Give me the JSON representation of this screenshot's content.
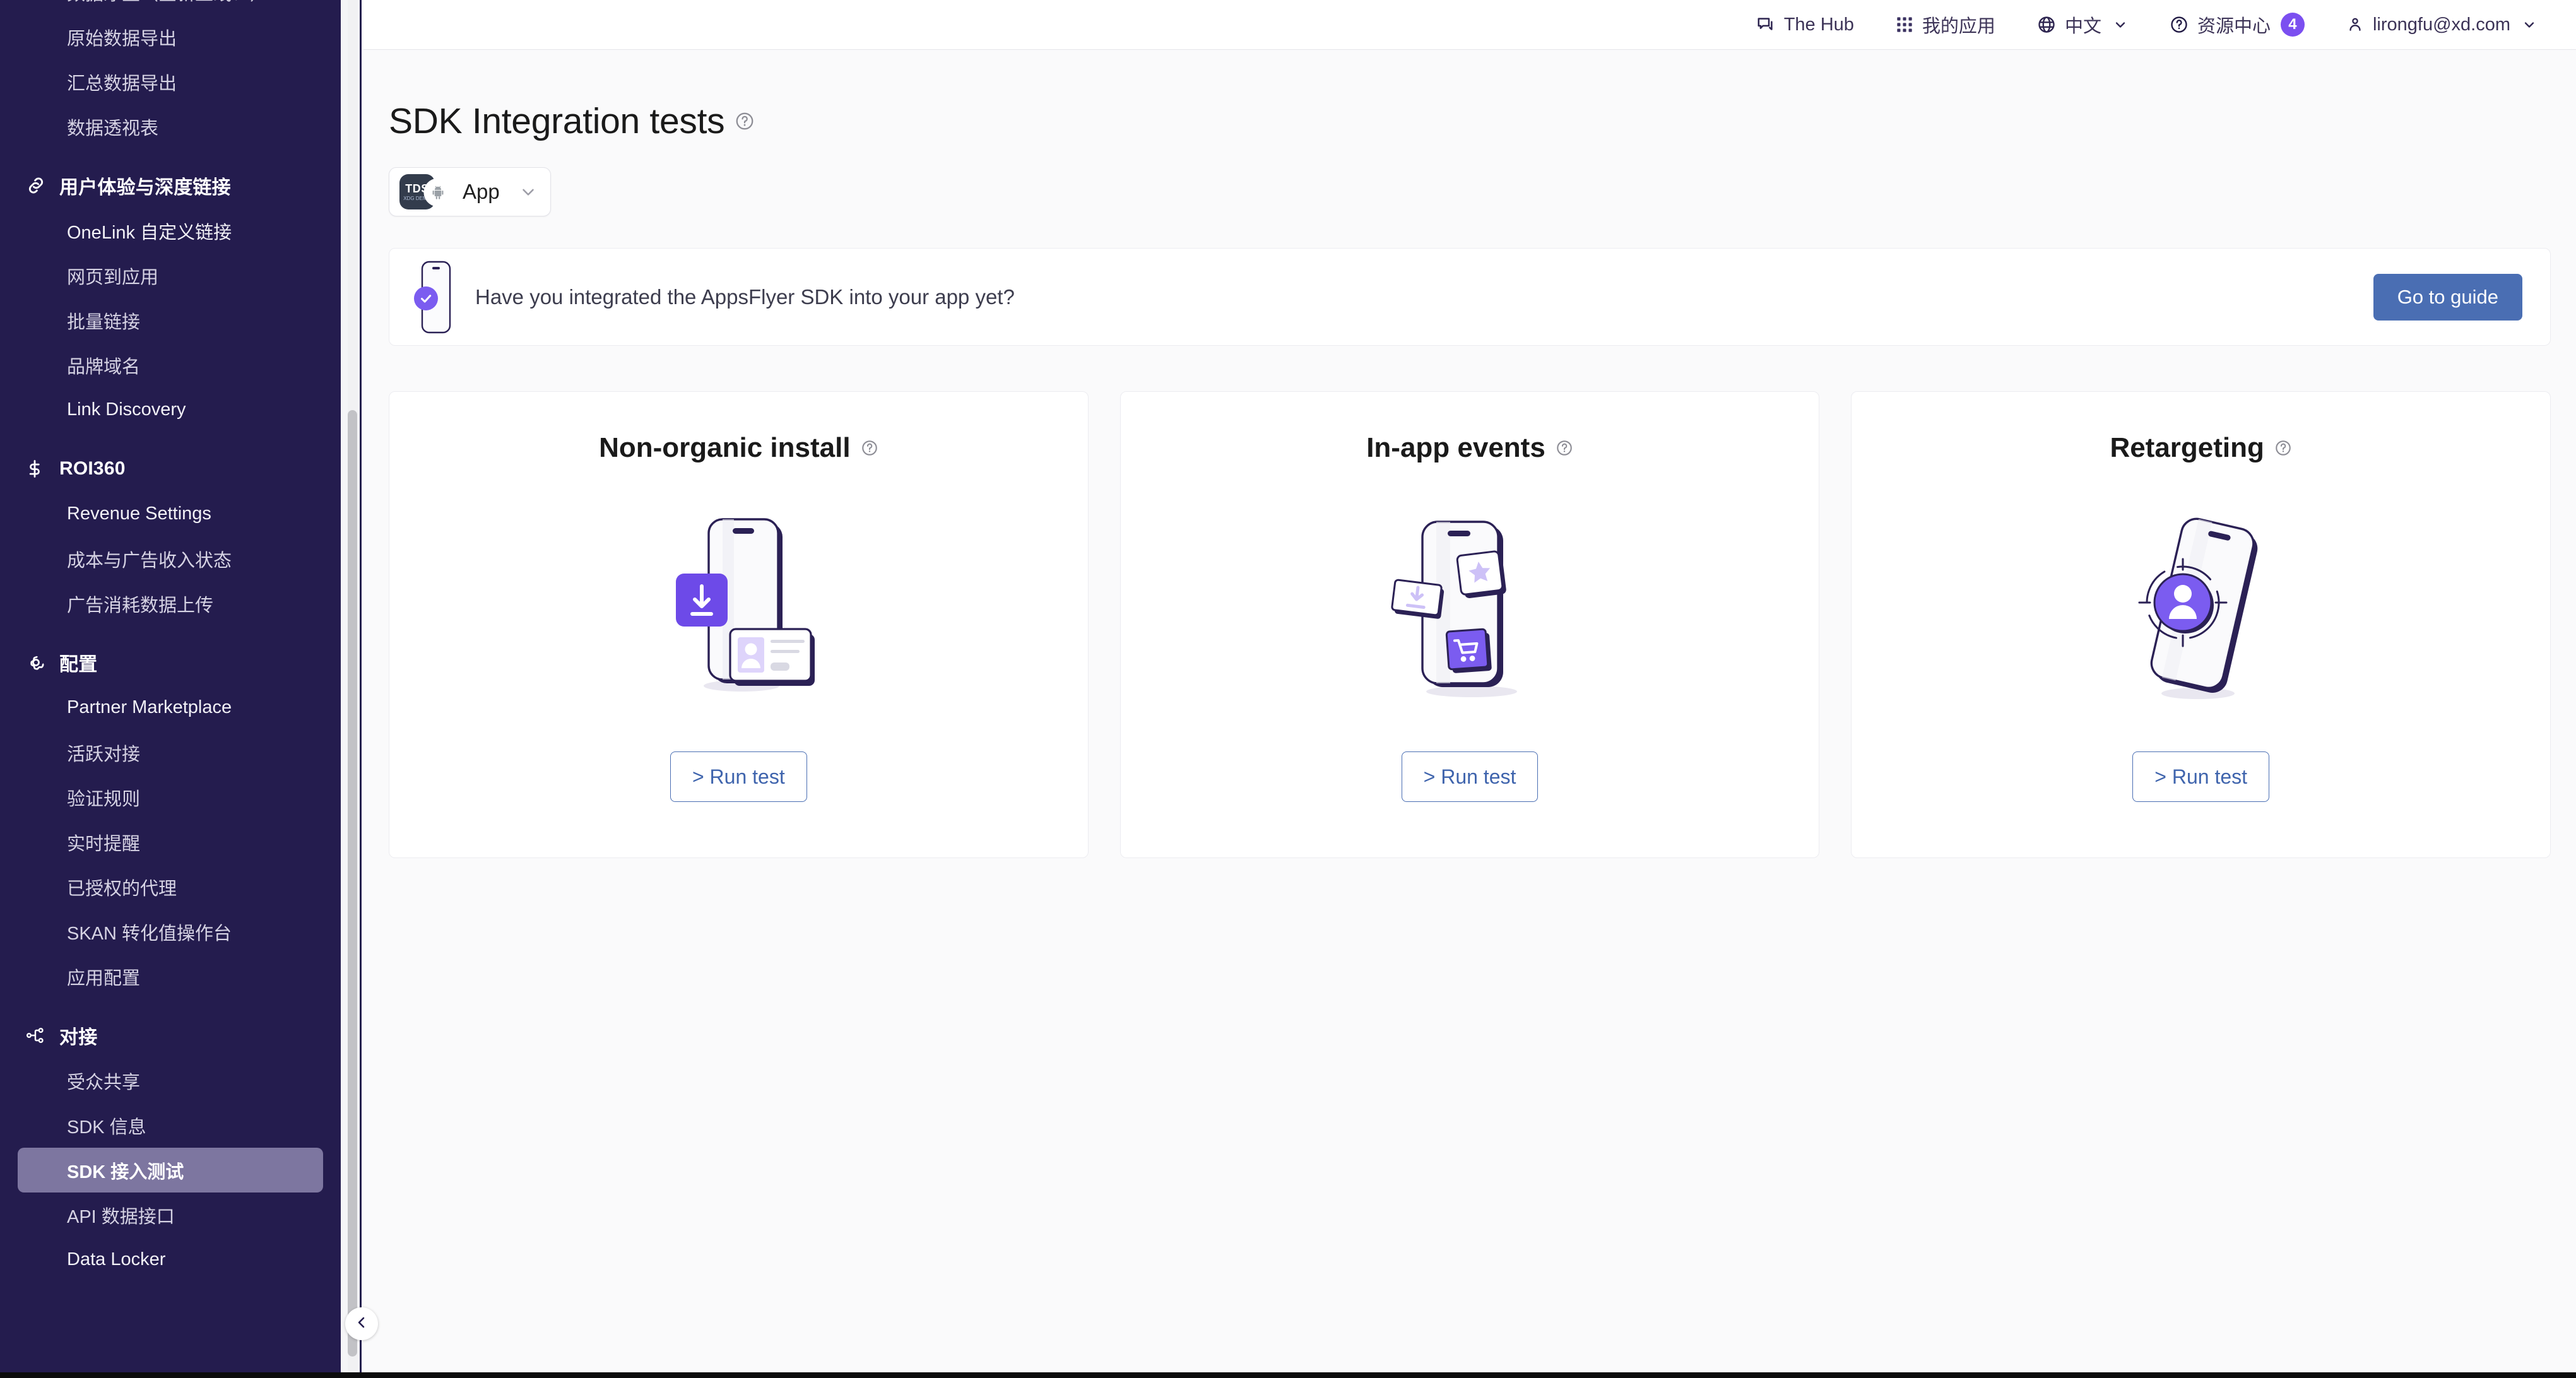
{
  "sidebar": {
    "sections": [
      {
        "header": null,
        "items": [
          {
            "label": "数据净室（全新上线！）",
            "latin": false,
            "active": false
          },
          {
            "label": "原始数据导出",
            "latin": false,
            "active": false
          },
          {
            "label": "汇总数据导出",
            "latin": false,
            "active": false
          },
          {
            "label": "数据透视表",
            "latin": false,
            "active": false
          }
        ]
      },
      {
        "header": {
          "label": "用户体验与深度链接",
          "icon": "link-icon"
        },
        "items": [
          {
            "label": "OneLink 自定义链接",
            "latin": false,
            "active": false
          },
          {
            "label": "网页到应用",
            "latin": false,
            "active": false
          },
          {
            "label": "批量链接",
            "latin": false,
            "active": false
          },
          {
            "label": "品牌域名",
            "latin": false,
            "active": false
          },
          {
            "label": "Link Discovery",
            "latin": true,
            "active": false
          }
        ]
      },
      {
        "header": {
          "label": "ROI360",
          "icon": "dollar-icon"
        },
        "items": [
          {
            "label": "Revenue Settings",
            "latin": true,
            "active": false
          },
          {
            "label": "成本与广告收入状态",
            "latin": false,
            "active": false
          },
          {
            "label": "广告消耗数据上传",
            "latin": false,
            "active": false
          }
        ]
      },
      {
        "header": {
          "label": "配置",
          "icon": "gear-icon"
        },
        "items": [
          {
            "label": "Partner Marketplace",
            "latin": true,
            "active": false
          },
          {
            "label": "活跃对接",
            "latin": false,
            "active": false
          },
          {
            "label": "验证规则",
            "latin": false,
            "active": false
          },
          {
            "label": "实时提醒",
            "latin": false,
            "active": false
          },
          {
            "label": "已授权的代理",
            "latin": false,
            "active": false
          },
          {
            "label": "SKAN 转化值操作台",
            "latin": false,
            "active": false
          },
          {
            "label": "应用配置",
            "latin": false,
            "active": false
          }
        ]
      },
      {
        "header": {
          "label": "对接",
          "icon": "integration-icon"
        },
        "items": [
          {
            "label": "受众共享",
            "latin": false,
            "active": false
          },
          {
            "label": "SDK 信息",
            "latin": false,
            "active": false
          },
          {
            "label": "SDK 接入测试",
            "latin": false,
            "active": true
          },
          {
            "label": "API 数据接口",
            "latin": false,
            "active": false
          },
          {
            "label": "Data Locker",
            "latin": true,
            "active": false
          }
        ]
      }
    ],
    "collapse_icon": "chevron-left-icon",
    "active_bg": "#7d76a0",
    "bg": "#241c4e"
  },
  "topnav": {
    "items": [
      {
        "label": "The Hub",
        "icon": "chat-bubble-icon",
        "chevron": false,
        "badge": null
      },
      {
        "label": "我的应用",
        "icon": "grid-apps-icon",
        "chevron": false,
        "badge": null
      },
      {
        "label": "中文",
        "icon": "globe-icon",
        "chevron": true,
        "badge": null
      },
      {
        "label": "资源中心",
        "icon": "question-circle-icon",
        "chevron": false,
        "badge": "4"
      },
      {
        "label": "lirongfu@xd.com",
        "icon": "user-icon",
        "chevron": true,
        "badge": null
      }
    ],
    "badge_color": "#7b4ff0"
  },
  "page": {
    "title": "SDK Integration tests",
    "title_help_icon": "question-circle-icon",
    "app_selector": {
      "icon_text_line1": "TDS",
      "icon_text_line2": "XDG DEMO",
      "platform_icon": "android-icon",
      "name": "App",
      "chevron_icon": "chevron-down-icon"
    }
  },
  "banner": {
    "illustration": "phone-check-icon",
    "text": "Have you integrated the AppsFlyer SDK into your app yet?",
    "button_label": "Go to guide",
    "button_color": "#4a6eb3"
  },
  "cards": [
    {
      "title": "Non-organic install",
      "help_icon": "question-circle-icon",
      "illustration": "phone-download-contact-card",
      "button_label": "> Run test"
    },
    {
      "title": "In-app events",
      "help_icon": "question-circle-icon",
      "illustration": "phone-events-tiles",
      "button_label": "> Run test"
    },
    {
      "title": "Retargeting",
      "help_icon": "question-circle-icon",
      "illustration": "phone-target-user",
      "button_label": "> Run test"
    }
  ],
  "colors": {
    "accent_purple": "#7b4ff0",
    "sidebar_bg": "#241c4e",
    "button_blue": "#4a6eb3",
    "page_bg": "#fafafb"
  }
}
